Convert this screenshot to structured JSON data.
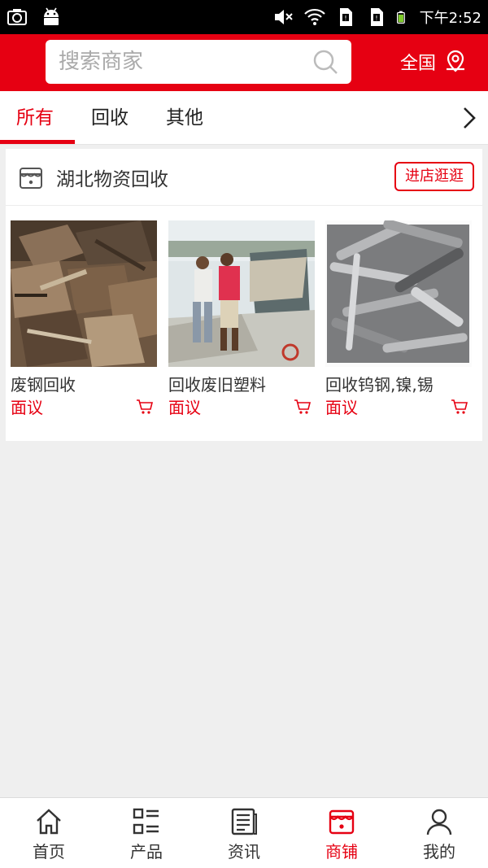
{
  "status_bar": {
    "time": "下午2:52",
    "icons": [
      "camera-icon",
      "android-icon",
      "mute-icon",
      "wifi-icon",
      "sim-card-icon",
      "sim-card-icon",
      "battery-icon"
    ]
  },
  "header": {
    "search_placeholder": "搜索商家",
    "region_label": "全国",
    "accent_color": "#e60012"
  },
  "tabs": {
    "items": [
      {
        "label": "所有",
        "active": true
      },
      {
        "label": "回收",
        "active": false
      },
      {
        "label": "其他",
        "active": false
      }
    ]
  },
  "store": {
    "name": "湖北物资回收",
    "visit_label": "进店逛逛",
    "products": [
      {
        "title": "废钢回收",
        "price": "面议",
        "image": "scrap-steel-photo"
      },
      {
        "title": "回收废旧塑料",
        "price": "面议",
        "image": "workers-plastic-recycling-photo"
      },
      {
        "title": "回收钨钢,镍,锡",
        "price": "面议",
        "image": "tungsten-steel-drill-bits-photo"
      }
    ]
  },
  "bottom_nav": {
    "items": [
      {
        "label": "首页",
        "icon": "home-icon",
        "active": false
      },
      {
        "label": "产品",
        "icon": "product-list-icon",
        "active": false
      },
      {
        "label": "资讯",
        "icon": "news-icon",
        "active": false
      },
      {
        "label": "商铺",
        "icon": "shop-icon",
        "active": true
      },
      {
        "label": "我的",
        "icon": "user-icon",
        "active": false
      }
    ]
  }
}
